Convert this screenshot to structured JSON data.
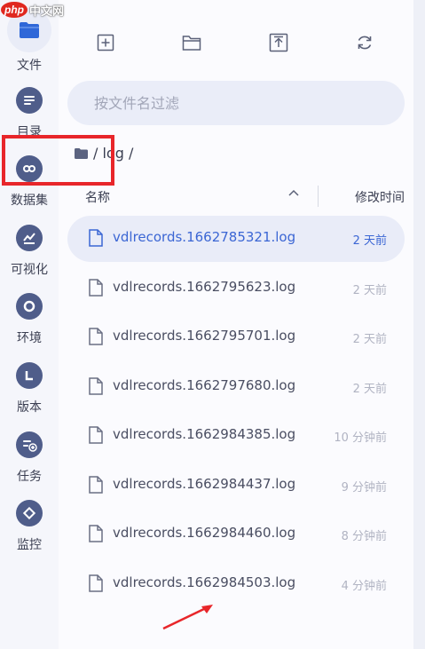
{
  "watermark": {
    "logo": "php",
    "text": "中文网"
  },
  "sidebar": {
    "items": [
      {
        "label": "文件",
        "icon": "folder-icon"
      },
      {
        "label": "目录",
        "icon": "list-icon"
      },
      {
        "label": "数据集",
        "icon": "dataset-icon"
      },
      {
        "label": "可视化",
        "icon": "chart-icon"
      },
      {
        "label": "环境",
        "icon": "circle-icon"
      },
      {
        "label": "版本",
        "icon": "version-icon"
      },
      {
        "label": "任务",
        "icon": "task-icon"
      },
      {
        "label": "监控",
        "icon": "monitor-icon"
      }
    ]
  },
  "filter": {
    "placeholder": "按文件名过滤"
  },
  "breadcrumb": {
    "path": "/ log /"
  },
  "list": {
    "col_name": "名称",
    "col_time": "修改时间",
    "rows": [
      {
        "name": "vdlrecords.1662785321.log",
        "time": "2 天前"
      },
      {
        "name": "vdlrecords.1662795623.log",
        "time": "2 天前"
      },
      {
        "name": "vdlrecords.1662795701.log",
        "time": "2 天前"
      },
      {
        "name": "vdlrecords.1662797680.log",
        "time": "2 天前"
      },
      {
        "name": "vdlrecords.1662984385.log",
        "time": "10 分钟前"
      },
      {
        "name": "vdlrecords.1662984437.log",
        "time": "9 分钟前"
      },
      {
        "name": "vdlrecords.1662984460.log",
        "time": "8 分钟前"
      },
      {
        "name": "vdlrecords.1662984503.log",
        "time": "4 分钟前"
      }
    ]
  },
  "colors": {
    "accent": "#3b66d4",
    "annotation": "#e8262a",
    "icon": "#4f5d8a"
  }
}
